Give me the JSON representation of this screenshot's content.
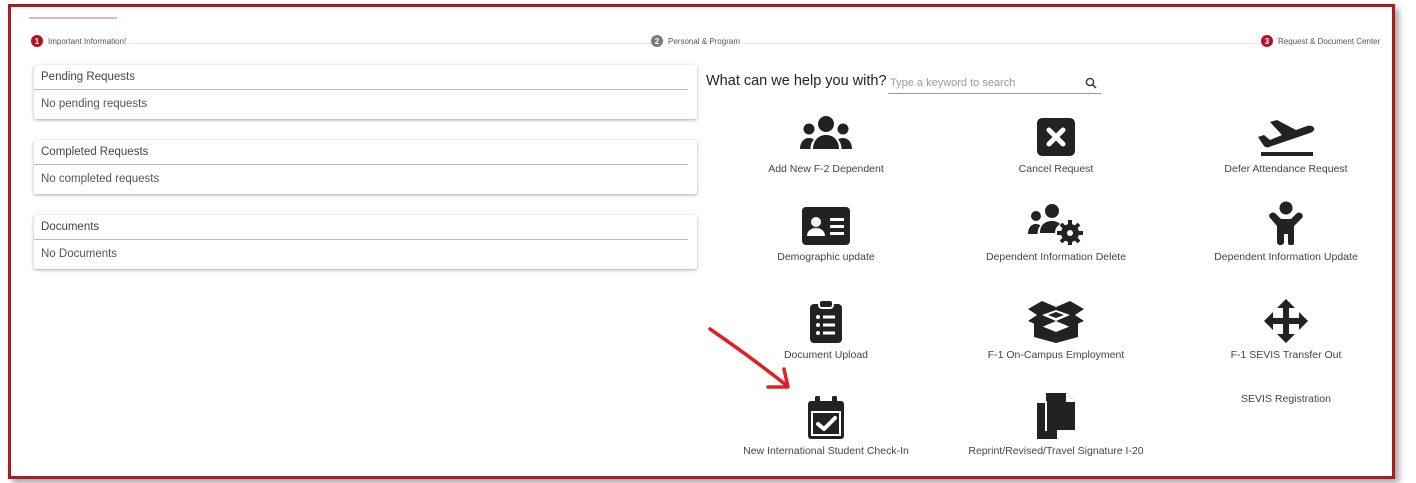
{
  "stepper": {
    "steps": [
      {
        "number": "1",
        "label": "Important Information!"
      },
      {
        "number": "2",
        "label": "Personal & Program"
      },
      {
        "number": "3",
        "label": "Request & Document Center"
      }
    ]
  },
  "cards": [
    {
      "title": "Pending Requests",
      "body": "No pending requests"
    },
    {
      "title": "Completed Requests",
      "body": "No completed requests"
    },
    {
      "title": "Documents",
      "body": "No Documents"
    }
  ],
  "help": {
    "title": "What can we help you with?",
    "search_placeholder": "Type a keyword to search",
    "search_value": ""
  },
  "tiles": [
    {
      "label": "Add New F-2 Dependent",
      "icon": "users-icon"
    },
    {
      "label": "Cancel Request",
      "icon": "cancel-box-icon"
    },
    {
      "label": "Defer Attendance Request",
      "icon": "plane-departure-icon"
    },
    {
      "label": "Demographic update",
      "icon": "id-card-icon"
    },
    {
      "label": "Dependent Information Delete",
      "icon": "users-gear-icon"
    },
    {
      "label": "Dependent Information Update",
      "icon": "child-icon"
    },
    {
      "label": "Document Upload",
      "icon": "clipboard-list-icon"
    },
    {
      "label": "F-1 On-Campus Employment",
      "icon": "open-box-icon"
    },
    {
      "label": "F-1 SEVIS Transfer Out",
      "icon": "move-arrows-icon"
    },
    {
      "label": "New International Student Check-In",
      "icon": "calendar-check-icon"
    },
    {
      "label": "Reprint/Revised/Travel Signature I-20",
      "icon": "copy-files-icon"
    },
    {
      "label": "SEVIS Registration",
      "icon": ""
    }
  ],
  "colors": {
    "accent": "#b01226",
    "frame": "#a81d1d",
    "annotation_arrow": "#e02020",
    "icon": "#222222"
  }
}
